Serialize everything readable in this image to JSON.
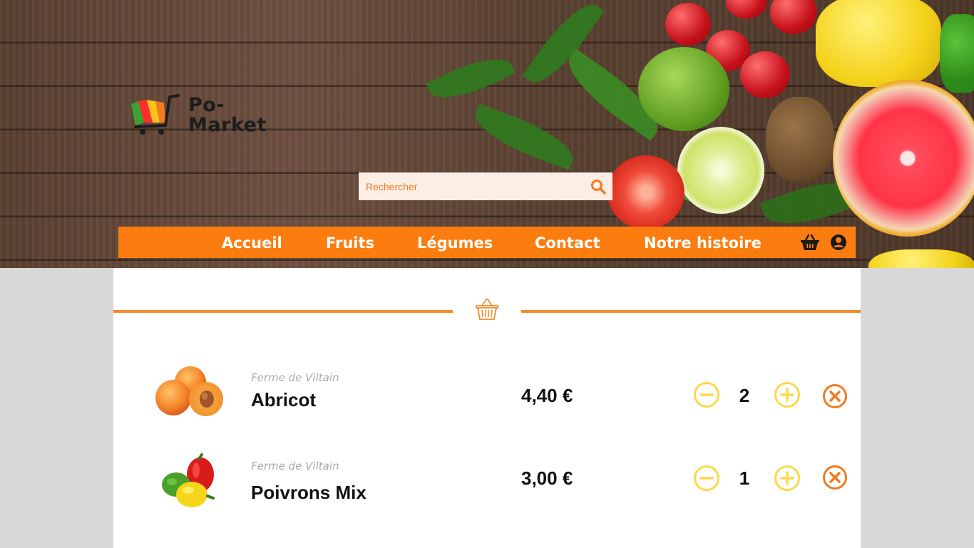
{
  "brand": {
    "logo_text_line1": "Po-",
    "logo_text_line2": "Market"
  },
  "search": {
    "placeholder": "Rechercher"
  },
  "nav": {
    "items": [
      "Accueil",
      "Fruits",
      "Légumes",
      "Contact",
      "Notre histoire"
    ],
    "icons": [
      "basket-icon",
      "user-account-icon"
    ]
  },
  "cart": {
    "section_icon": "basket-icon",
    "items": [
      {
        "farm": "Ferme de Viltain",
        "name": "Abricot",
        "price": "4,40 €",
        "quantity": "2",
        "image": "apricot-image"
      },
      {
        "farm": "Ferme de Viltain",
        "name": "Poivrons Mix",
        "price": "3,00 €",
        "quantity": "1",
        "image": "mixed-peppers-image"
      }
    ]
  },
  "colors": {
    "accent": "#fb7d10",
    "divider": "#f28a2c",
    "quantity_buttons": "#fdd84a",
    "remove_button": "#f07b22",
    "background": "#d8d8d8",
    "panel": "#ffffff"
  }
}
